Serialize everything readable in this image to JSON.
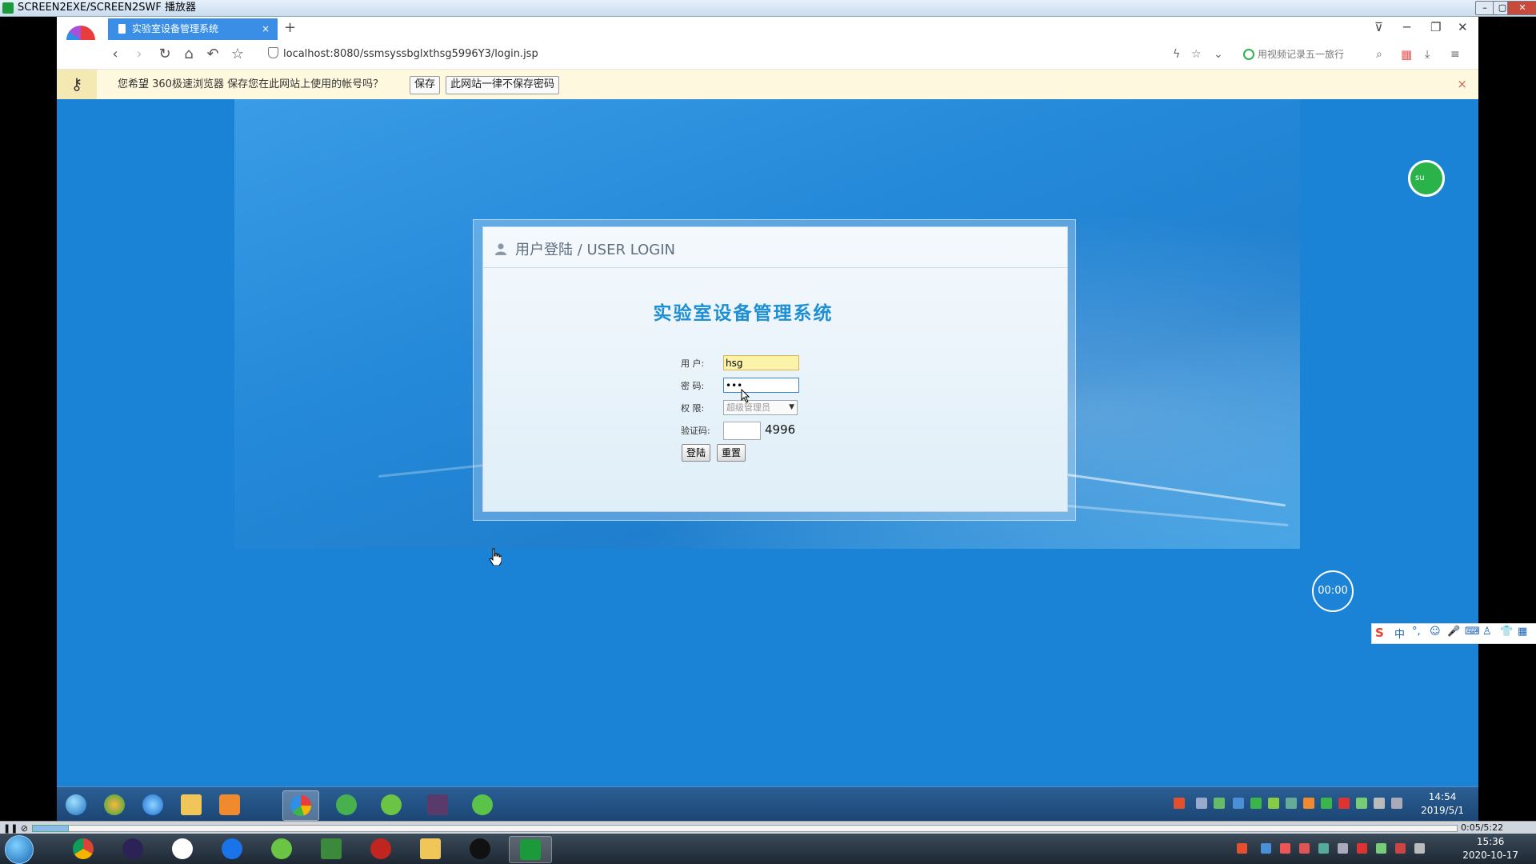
{
  "player": {
    "title": "SCREEN2EXE/SCREEN2SWF 播放器",
    "minimize": "–",
    "maximize": "▢",
    "close": "✕",
    "elapsed": "0:05/5:22"
  },
  "browser": {
    "tab_title": "实验室设备管理系统",
    "tab_close": "×",
    "new_tab": "+",
    "url": "localhost:8080/ssmsyssbglxthsg5996Y3/login.jsp",
    "video_record_hint": "用视频记录五一旅行",
    "savebar": {
      "message": "您希望 360极速浏览器 保存您在此网站上使用的帐号吗？",
      "save_label": "保存",
      "never_label": "此网站一律不保存密码",
      "close": "×"
    }
  },
  "login": {
    "header": "用户登陆 / USER LOGIN",
    "system_title": "实验室设备管理系统",
    "user_label": "用  户:",
    "user_value": "hsg",
    "pass_label": "密  码:",
    "pass_value": "•••",
    "role_label": "权  限:",
    "role_value": "超级管理员",
    "captcha_label": "验证码:",
    "captcha_code": "4996",
    "login_button": "登陆",
    "reset_button": "重置"
  },
  "overlay": {
    "timer": "00:00",
    "side_badge": "su",
    "ime_logo": "S",
    "ime_mode": "中"
  },
  "inner_taskbar": {
    "time": "14:54",
    "date": "2019/5/1"
  },
  "host_taskbar": {
    "time": "15:36",
    "date": "2020-10-17"
  }
}
